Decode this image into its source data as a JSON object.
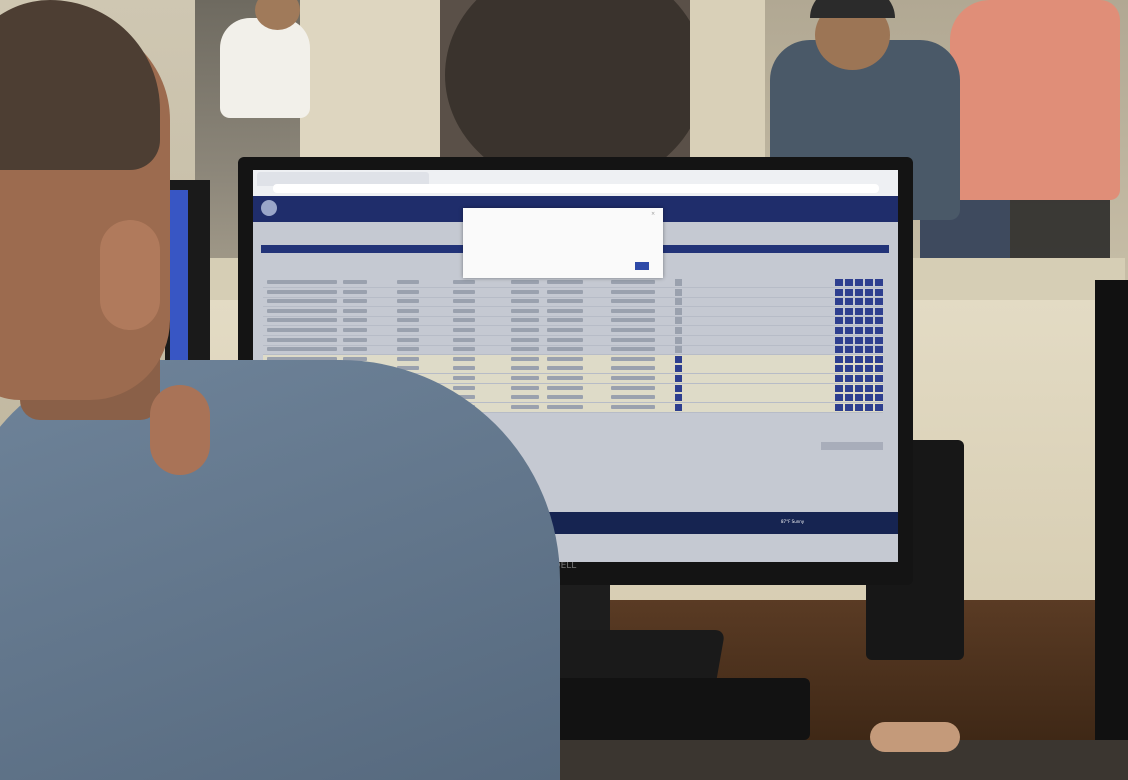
{
  "browser": {
    "tabs": [
      "",
      ""
    ],
    "url": ""
  },
  "app": {
    "nav_items": [
      "",
      "",
      "",
      ""
    ],
    "page_title": "",
    "section_label": ""
  },
  "dialog": {
    "title": "",
    "body": "",
    "cancel_label": "",
    "ok_label": ""
  },
  "taskbar": {
    "search_placeholder": "",
    "weather": "87°F Sunny",
    "time": ""
  },
  "monitor": {
    "brand": "DELL"
  },
  "colors": {
    "app_header": "#1f2d6b",
    "taskbar": "#162451",
    "action_button": "#2e3f8f",
    "highlight_row": "#dedbc8"
  }
}
